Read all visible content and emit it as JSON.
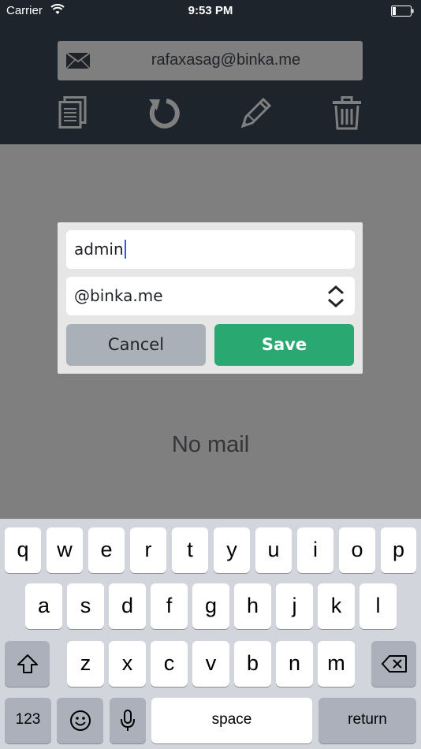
{
  "status_bar": {
    "carrier": "Carrier",
    "time": "9:53 PM",
    "icons": [
      "wifi-icon",
      "battery-icon"
    ]
  },
  "header": {
    "email": "rafaxasag@binka.me",
    "email_icon": "envelope-icon",
    "toolbar": [
      "copy-icon",
      "refresh-icon",
      "edit-pencil-icon",
      "trash-icon"
    ]
  },
  "main": {
    "empty_text": "No mail"
  },
  "dialog": {
    "username_value": "admin",
    "domain_value": "@binka.me",
    "cancel_label": "Cancel",
    "save_label": "Save"
  },
  "keyboard": {
    "row1": [
      "q",
      "w",
      "e",
      "r",
      "t",
      "y",
      "u",
      "i",
      "o",
      "p"
    ],
    "row2": [
      "a",
      "s",
      "d",
      "f",
      "g",
      "h",
      "j",
      "k",
      "l"
    ],
    "row3": [
      "z",
      "x",
      "c",
      "v",
      "b",
      "n",
      "m"
    ],
    "numbers_label": "123",
    "space_label": "space",
    "return_label": "return"
  },
  "colors": {
    "header_bg": "#1e242c",
    "overlay_bg": "#7f7f7f",
    "save_green": "#2aa872",
    "cancel_gray": "#aab0b7",
    "keyboard_bg": "#d2d5db"
  }
}
